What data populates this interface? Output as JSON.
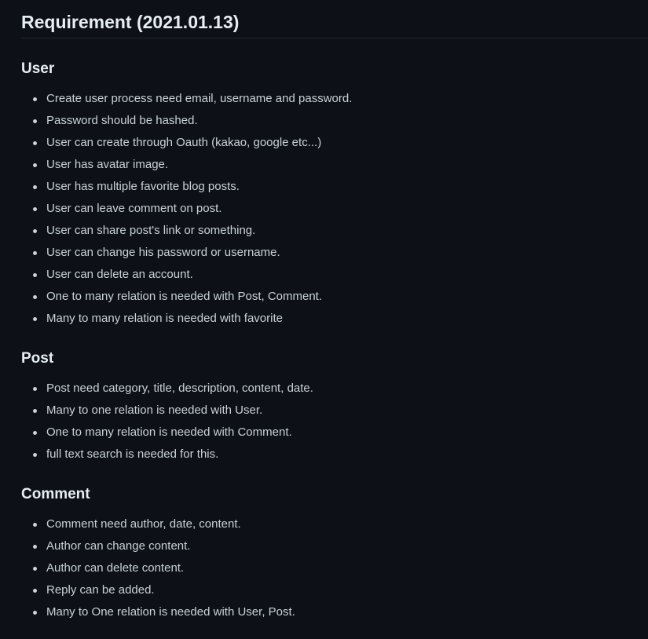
{
  "title": "Requirement (2021.01.13)",
  "sections": [
    {
      "heading": "User",
      "items": [
        "Create user process need email, username and password.",
        "Password should be hashed.",
        "User can create through Oauth (kakao, google etc...)",
        "User has avatar image.",
        "User has multiple favorite blog posts.",
        "User can leave comment on post.",
        "User can share post's link or something.",
        "User can change his password or username.",
        "User can delete an account.",
        "One to many relation is needed with Post, Comment.",
        "Many to many relation is needed with favorite"
      ]
    },
    {
      "heading": "Post",
      "items": [
        "Post need category, title, description, content, date.",
        "Many to one relation is needed with User.",
        "One to many relation is needed with Comment.",
        "full text search is needed for this."
      ]
    },
    {
      "heading": "Comment",
      "items": [
        "Comment need author, date, content.",
        "Author can change content.",
        "Author can delete content.",
        "Reply can be added.",
        "Many to One relation is needed with User, Post."
      ]
    }
  ]
}
